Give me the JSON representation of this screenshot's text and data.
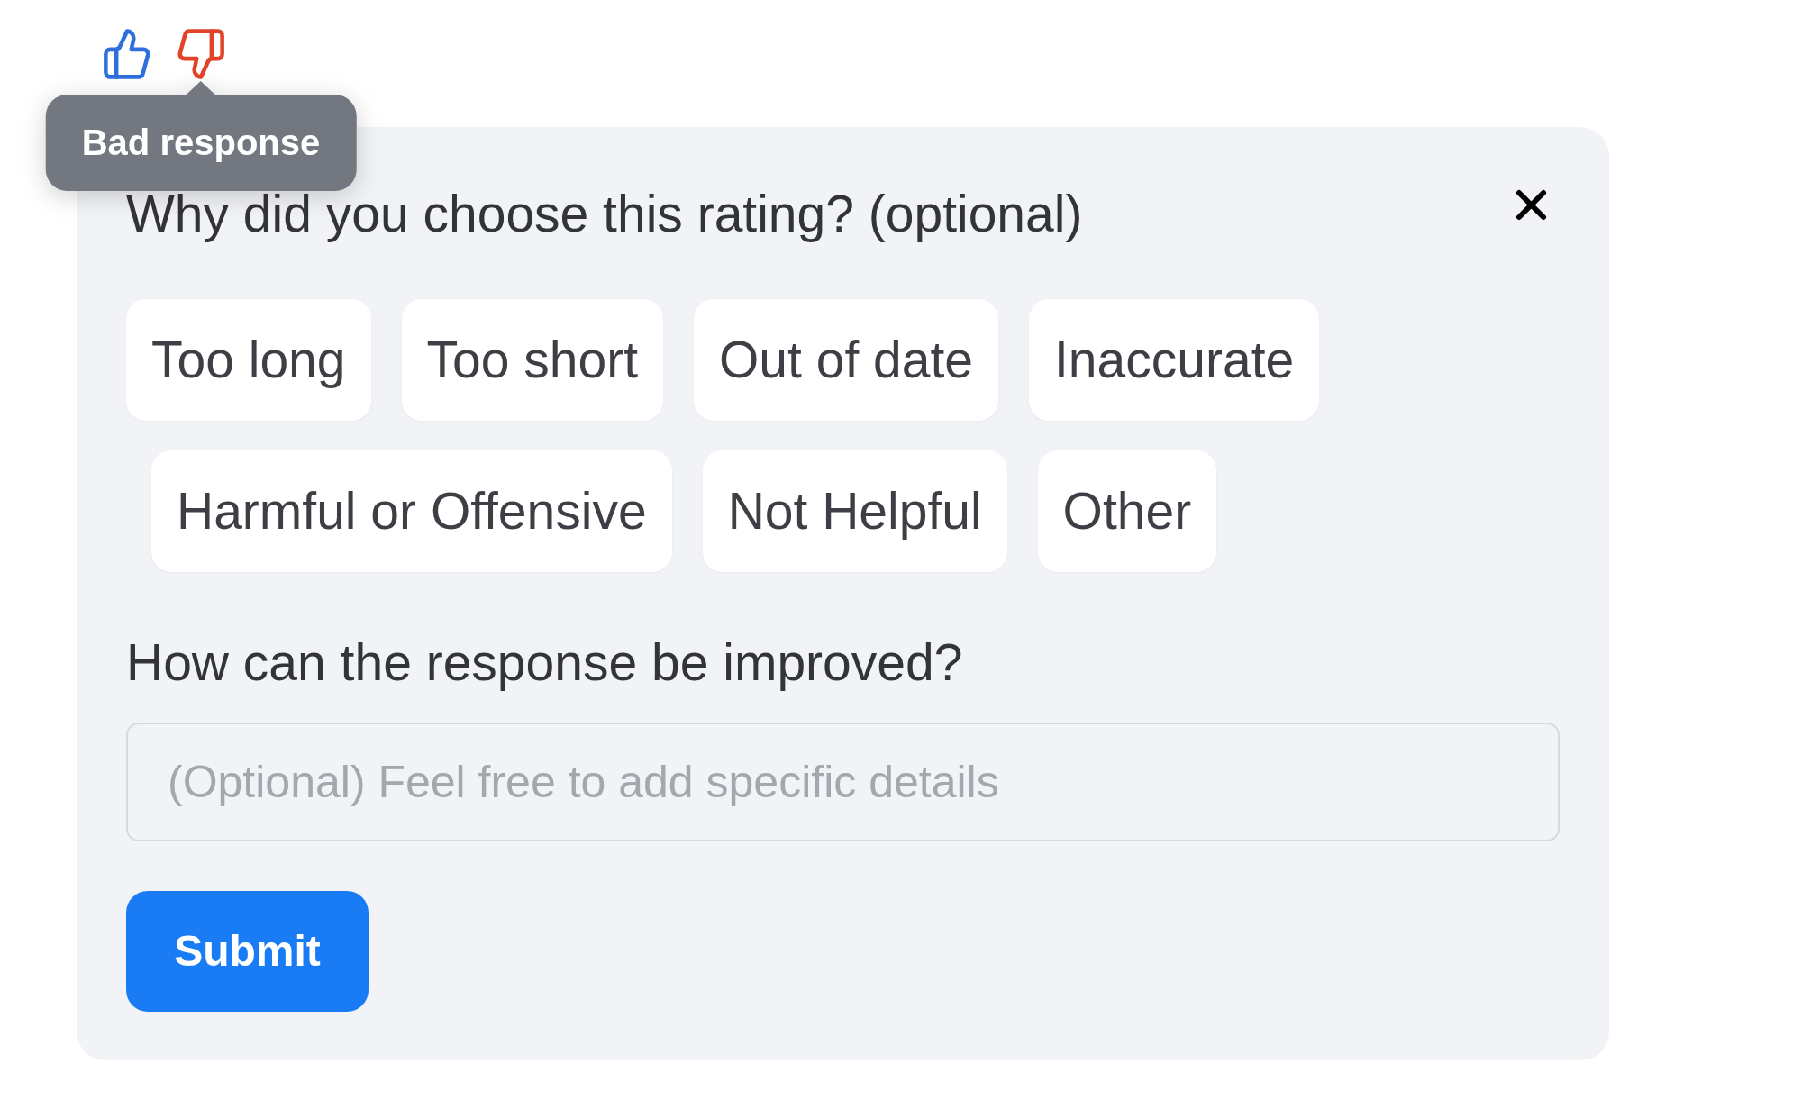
{
  "rating_buttons": [
    {
      "kind": "thumbs_up",
      "selected": false
    },
    {
      "kind": "thumbs_down",
      "selected": true,
      "tooltip": "Bad response"
    }
  ],
  "feedback_panel": {
    "question": "Why did you choose this rating? (optional)",
    "reason_rows": [
      {
        "options": [
          {
            "label": "Too long",
            "selected": false
          },
          {
            "label": "Too short",
            "selected": false
          },
          {
            "label": "Out of date",
            "selected": false
          },
          {
            "label": "Inaccurate",
            "selected": false
          }
        ]
      },
      {
        "options": [
          {
            "label": "Harmful or Offensive",
            "selected": false
          },
          {
            "label": "Not Helpful",
            "selected": false
          },
          {
            "label": "Other",
            "selected": false
          }
        ]
      }
    ],
    "details_label": "How can the response be improved?",
    "details_field": {
      "placeholder": "(Optional) Feel free to add specific details"
    },
    "submit_button": "Submit"
  }
}
